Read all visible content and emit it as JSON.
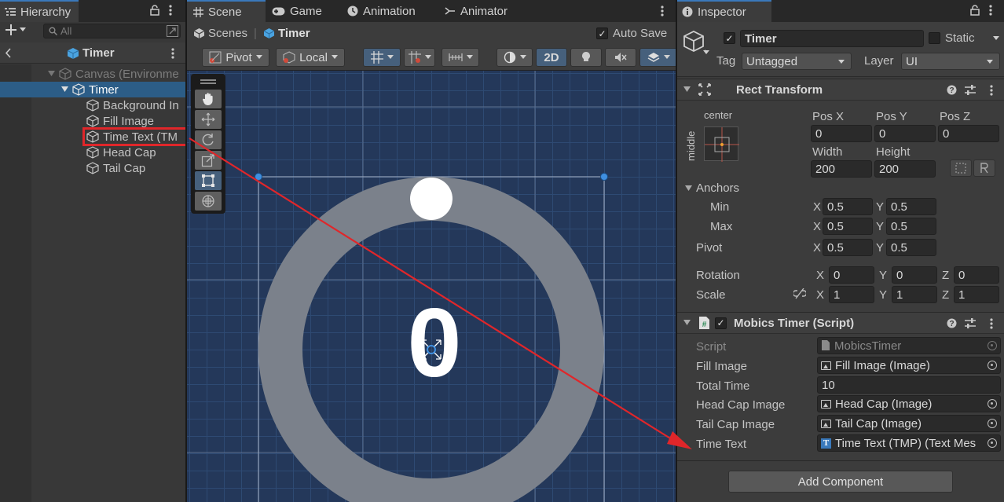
{
  "hierarchy": {
    "tab_label": "Hierarchy",
    "search_placeholder": "All",
    "scene_name": "Timer",
    "items": [
      {
        "label": "Canvas (Environme",
        "state": "dimmed"
      },
      {
        "label": "Timer",
        "state": "selected"
      },
      {
        "label": "Background In",
        "state": "normal"
      },
      {
        "label": "Fill Image",
        "state": "normal"
      },
      {
        "label": "Time Text (TM",
        "state": "highlighted"
      },
      {
        "label": "Head Cap",
        "state": "normal"
      },
      {
        "label": "Tail Cap",
        "state": "normal"
      }
    ]
  },
  "scene": {
    "tabs": [
      "Scene",
      "Game",
      "Animation",
      "Animator"
    ],
    "breadcrumb": {
      "root": "Scenes",
      "current": "Timer"
    },
    "auto_save_label": "Auto Save",
    "auto_save_checked": true,
    "toolbar": {
      "pivot": "Pivot",
      "space": "Local",
      "mode_2d": "2D"
    },
    "timer_digit": "0"
  },
  "inspector": {
    "tab_label": "Inspector",
    "object_name": "Timer",
    "static_label": "Static",
    "tag_label": "Tag",
    "tag_value": "Untagged",
    "layer_label": "Layer",
    "layer_value": "UI",
    "rect_transform": {
      "title": "Rect Transform",
      "anchor_preset_h": "center",
      "anchor_preset_v": "middle",
      "pos_x_label": "Pos X",
      "pos_x": "0",
      "pos_y_label": "Pos Y",
      "pos_y": "0",
      "pos_z_label": "Pos Z",
      "pos_z": "0",
      "width_label": "Width",
      "width": "200",
      "height_label": "Height",
      "height": "200",
      "anchors_label": "Anchors",
      "min_label": "Min",
      "min_x": "0.5",
      "min_y": "0.5",
      "max_label": "Max",
      "max_x": "0.5",
      "max_y": "0.5",
      "pivot_label": "Pivot",
      "pivot_x": "0.5",
      "pivot_y": "0.5",
      "rotation_label": "Rotation",
      "rot_x": "0",
      "rot_y": "0",
      "rot_z": "0",
      "scale_label": "Scale",
      "scale_x": "1",
      "scale_y": "1",
      "scale_z": "1",
      "x_label": "X",
      "y_label": "Y",
      "z_label": "Z"
    },
    "script_component": {
      "title": "Mobics Timer (Script)",
      "script_label": "Script",
      "script_value": "MobicsTimer",
      "fill_image_label": "Fill Image",
      "fill_image_value": "Fill Image (Image)",
      "total_time_label": "Total Time",
      "total_time_value": "10",
      "head_cap_label": "Head Cap Image",
      "head_cap_value": "Head Cap (Image)",
      "tail_cap_label": "Tail Cap Image",
      "tail_cap_value": "Tail Cap (Image)",
      "time_text_label": "Time Text",
      "time_text_value": "Time Text (TMP) (Text Mes"
    },
    "add_component_label": "Add Component"
  },
  "colors": {
    "accent_blue": "#3a79bb",
    "selection": "#2c5d87",
    "annotation_red": "#e0262a",
    "ring_gray": "#7b818b",
    "grid_blue": "#24385a"
  }
}
